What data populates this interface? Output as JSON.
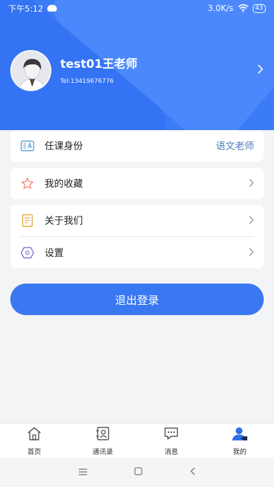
{
  "status_bar": {
    "time": "下午5:12",
    "network_speed": "3.0K/s",
    "battery": "43"
  },
  "profile": {
    "name": "test01王老师",
    "tel": "Tel:13419676776"
  },
  "menu": {
    "role": {
      "label": "任课身份",
      "value": "语文老师",
      "icon": "id-card-icon"
    },
    "favorites": {
      "label": "我的收藏",
      "icon": "star-icon"
    },
    "about": {
      "label": "关于我们",
      "icon": "book-icon"
    },
    "settings": {
      "label": "设置",
      "icon": "hexagon-settings-icon"
    }
  },
  "logout_label": "退出登录",
  "tabs": [
    {
      "label": "首页",
      "icon": "home-icon"
    },
    {
      "label": "通讯录",
      "icon": "contacts-icon"
    },
    {
      "label": "消息",
      "icon": "message-icon"
    },
    {
      "label": "我的",
      "icon": "user-icon"
    }
  ],
  "colors": {
    "primary": "#3b7cf6",
    "role_value": "#4d7ac4"
  }
}
